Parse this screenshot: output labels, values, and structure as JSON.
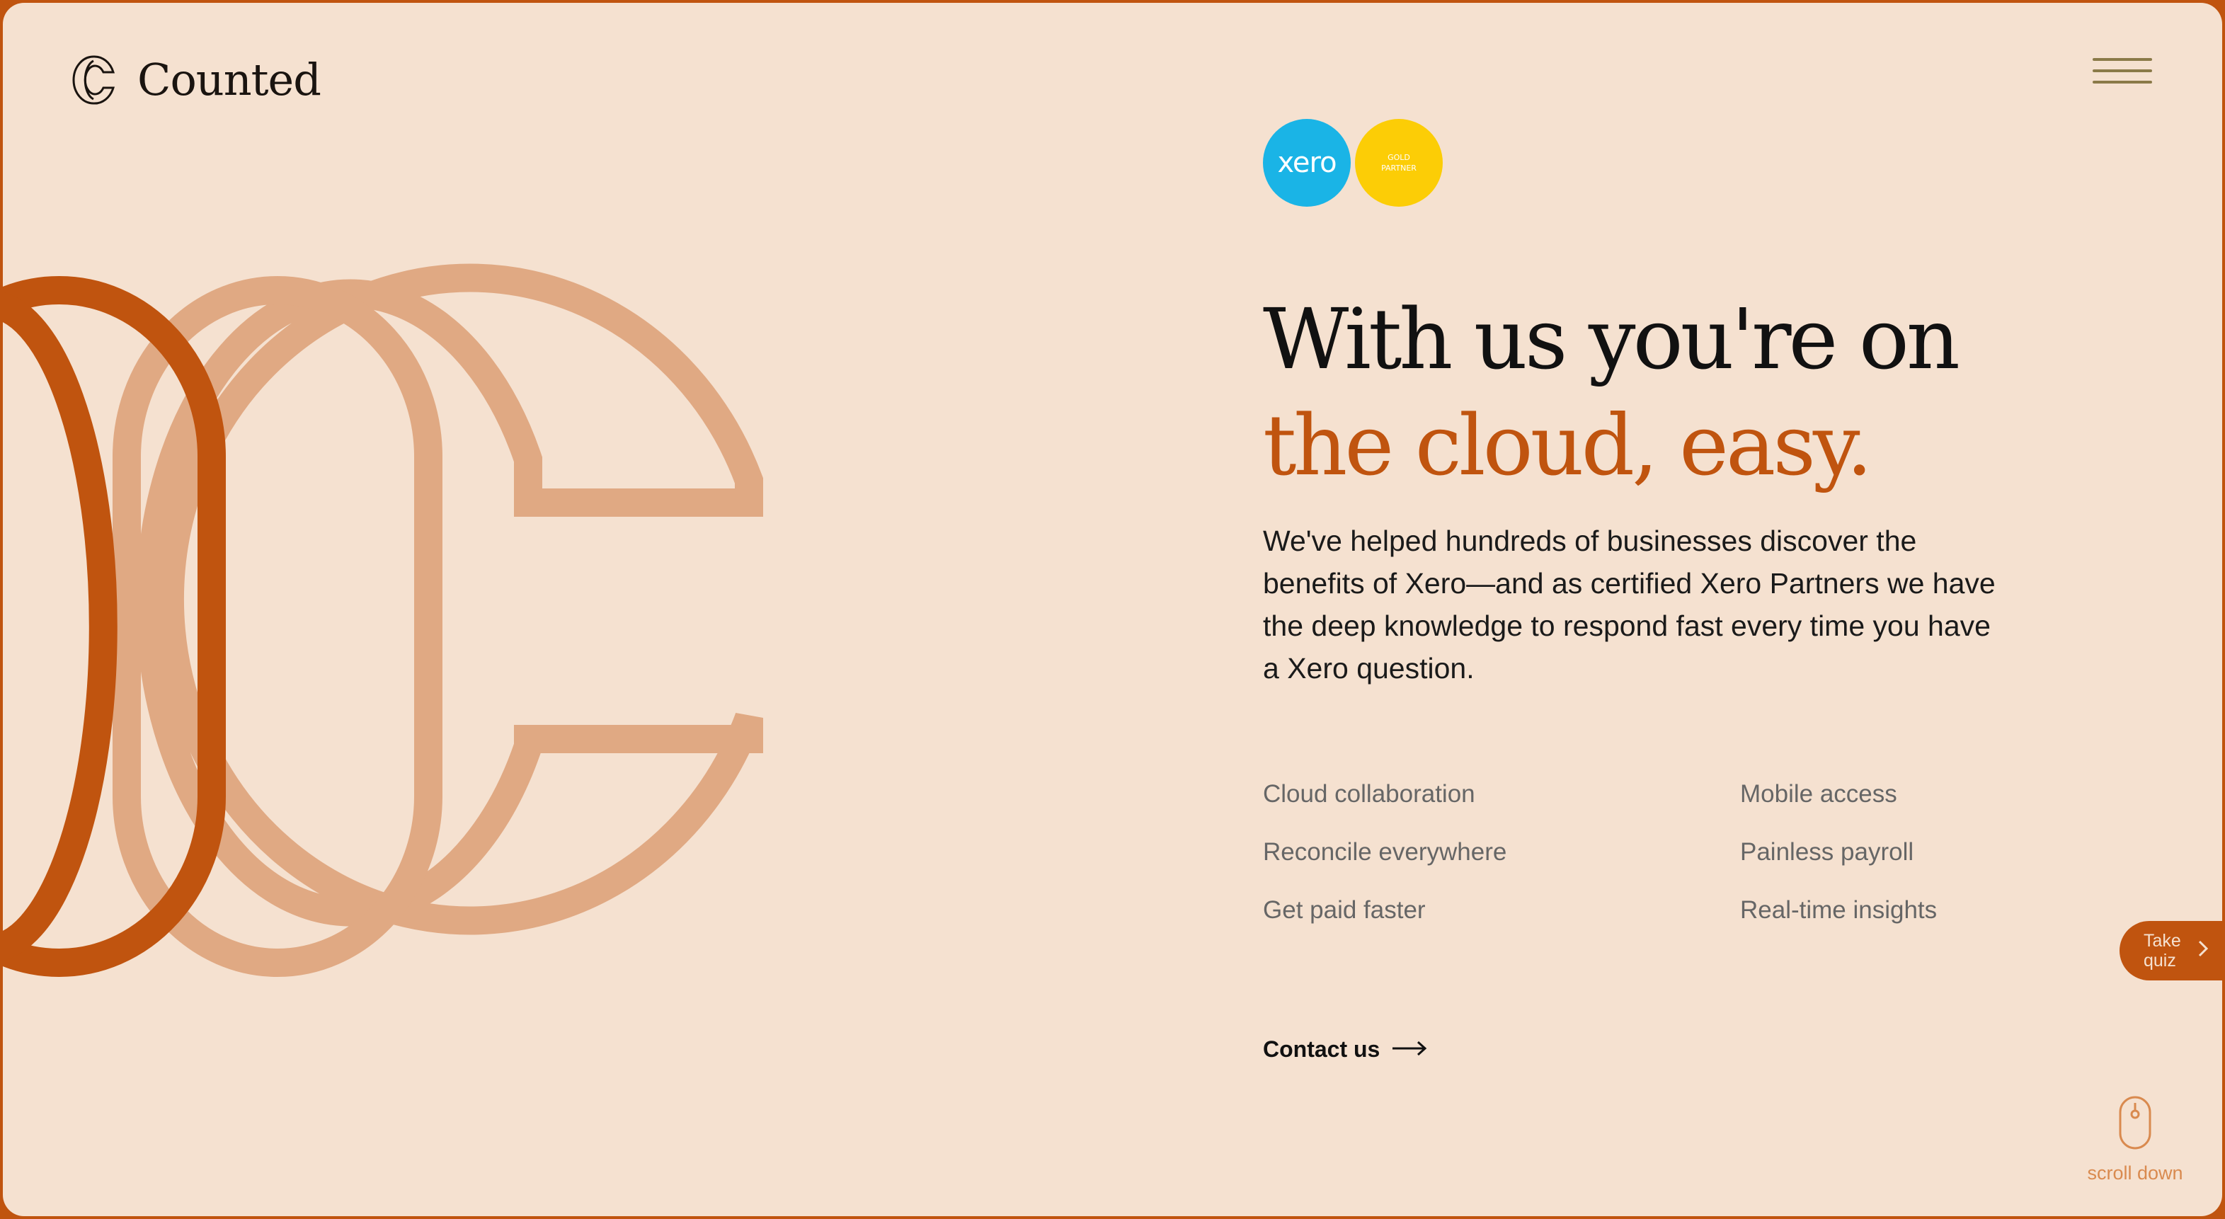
{
  "brand": {
    "name": "Counted",
    "logo_icon": "counted-logo-icon",
    "accent_color": "#c0540f",
    "background_color": "#f5e1d0",
    "graphic_light_color": "#e0a983"
  },
  "header": {
    "menu_icon": "hamburger-menu-icon"
  },
  "badges": {
    "xero_logo_text": "xero",
    "gold_partner_line1": "GOLD",
    "gold_partner_line2": "PARTNER"
  },
  "hero": {
    "heading_line1": "With us you're on",
    "heading_line2": "the cloud, easy.",
    "intro": "We've helped hundreds of businesses discover the benefits of Xero—and as certified Xero Partners we have the deep knowledge to respond fast every time you have a Xero question."
  },
  "features": [
    "Cloud collaboration",
    "Mobile access",
    "Reconcile everywhere",
    "Painless payroll",
    "Get paid faster",
    "Real-time insights"
  ],
  "contact": {
    "label": "Contact us",
    "icon": "arrow-right-icon"
  },
  "quiz": {
    "line1": "Take",
    "line2": "quiz",
    "icon": "chevron-right-icon"
  },
  "scroll": {
    "label": "scroll down",
    "icon": "mouse-icon"
  }
}
